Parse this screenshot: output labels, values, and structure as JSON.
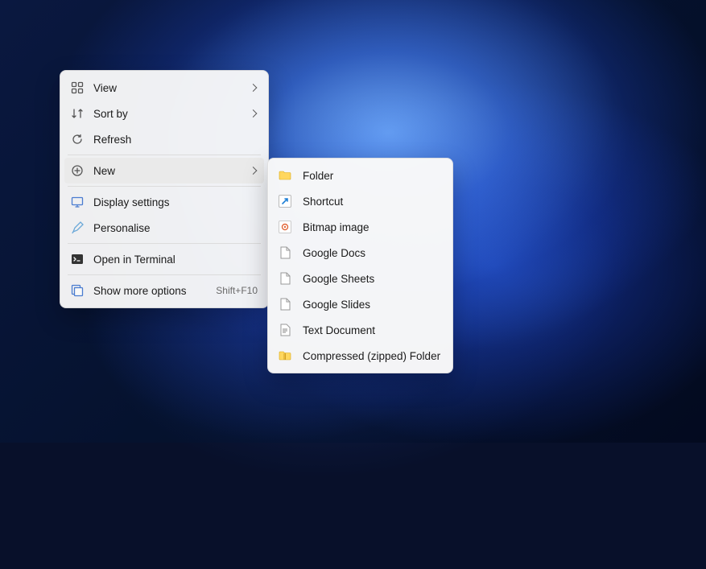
{
  "menu": {
    "view": "View",
    "sort_by": "Sort by",
    "refresh": "Refresh",
    "new": "New",
    "display_settings": "Display settings",
    "personalise": "Personalise",
    "open_in_terminal": "Open in Terminal",
    "show_more_options": "Show more options",
    "show_more_shortcut": "Shift+F10"
  },
  "submenu": {
    "folder": "Folder",
    "shortcut": "Shortcut",
    "bitmap_image": "Bitmap image",
    "google_docs": "Google Docs",
    "google_sheets": "Google Sheets",
    "google_slides": "Google Slides",
    "text_document": "Text Document",
    "compressed_folder": "Compressed (zipped) Folder"
  }
}
